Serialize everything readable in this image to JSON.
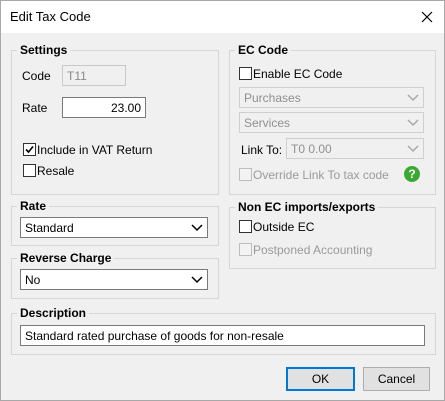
{
  "window": {
    "title": "Edit Tax Code"
  },
  "settings": {
    "title": "Settings",
    "code_label": "Code",
    "code_value": "T11",
    "rate_label": "Rate",
    "rate_value": "23.00",
    "include_vat_label": "Include in VAT Return",
    "include_vat_checked": true,
    "resale_label": "Resale",
    "resale_checked": false
  },
  "ec_code": {
    "title": "EC Code",
    "enable_label": "Enable EC Code",
    "enable_checked": false,
    "dropdown1_value": "Purchases",
    "dropdown2_value": "Services",
    "link_to_label": "Link To:",
    "link_to_value": "T0  0.00",
    "override_label": "Override Link To tax code",
    "override_checked": false
  },
  "rate": {
    "title": "Rate",
    "value": "Standard"
  },
  "reverse_charge": {
    "title": "Reverse Charge",
    "value": "No"
  },
  "non_ec": {
    "title": "Non EC imports/exports",
    "outside_ec_label": "Outside EC",
    "outside_ec_checked": false,
    "postponed_label": "Postponed Accounting",
    "postponed_checked": false
  },
  "description": {
    "title": "Description",
    "value": "Standard rated purchase of goods for non-resale"
  },
  "buttons": {
    "ok": "OK",
    "cancel": "Cancel"
  },
  "help_icon_glyph": "?",
  "colors": {
    "accent": "#0078d7",
    "help": "#3aa832"
  }
}
